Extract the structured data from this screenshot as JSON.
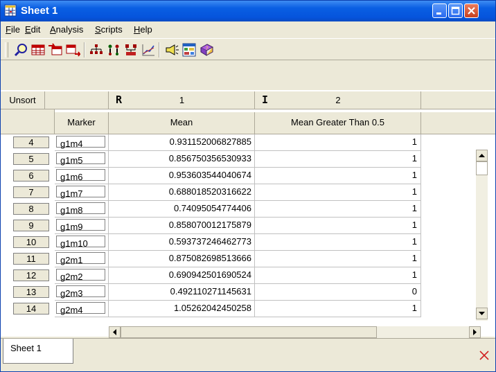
{
  "window": {
    "title": "Sheet 1"
  },
  "menu": [
    {
      "label": "File",
      "u": "F",
      "rest": "ile"
    },
    {
      "label": "Edit",
      "u": "E",
      "rest": "dit"
    },
    {
      "label": "Analysis",
      "u": "A",
      "rest": "nalysis"
    },
    {
      "label": "Scripts",
      "u": "S",
      "rest": "cripts"
    },
    {
      "label": "Help",
      "u": "H",
      "rest": "elp"
    }
  ],
  "toolbar_icons": [
    "zoom-icon",
    "table-icon",
    "import-icon",
    "export-icon",
    "tree-icon",
    "cluster-icon",
    "pedigree-icon",
    "chart-icon",
    "announce-icon",
    "grid-icon",
    "help-book-icon"
  ],
  "grid": {
    "unsort_label": "Unsort",
    "col1_type": "R",
    "col1_number": "1",
    "col2_type": "I",
    "col2_number": "2",
    "col_marker": "Marker",
    "col_mean": "Mean",
    "col_gt": "Mean Greater Than 0.5",
    "rows": [
      {
        "num": "4",
        "marker": "g1m4",
        "mean": "0.931152006827885",
        "gt": "1"
      },
      {
        "num": "5",
        "marker": "g1m5",
        "mean": "0.856750356530933",
        "gt": "1"
      },
      {
        "num": "6",
        "marker": "g1m6",
        "mean": "0.953603544040674",
        "gt": "1"
      },
      {
        "num": "7",
        "marker": "g1m7",
        "mean": "0.688018520316622",
        "gt": "1"
      },
      {
        "num": "8",
        "marker": "g1m8",
        "mean": "0.74095054774406",
        "gt": "1"
      },
      {
        "num": "9",
        "marker": "g1m9",
        "mean": "0.858070012175879",
        "gt": "1"
      },
      {
        "num": "10",
        "marker": "g1m10",
        "mean": "0.593737246462773",
        "gt": "1"
      },
      {
        "num": "11",
        "marker": "g2m1",
        "mean": "0.875082698513666",
        "gt": "1"
      },
      {
        "num": "12",
        "marker": "g2m2",
        "mean": "0.690942501690524",
        "gt": "1"
      },
      {
        "num": "13",
        "marker": "g2m3",
        "mean": "0.492110271145631",
        "gt": "0"
      },
      {
        "num": "14",
        "marker": "g2m4",
        "mean": "1.05262042450258",
        "gt": "1"
      }
    ]
  },
  "tabs": {
    "active": "Sheet 1"
  }
}
